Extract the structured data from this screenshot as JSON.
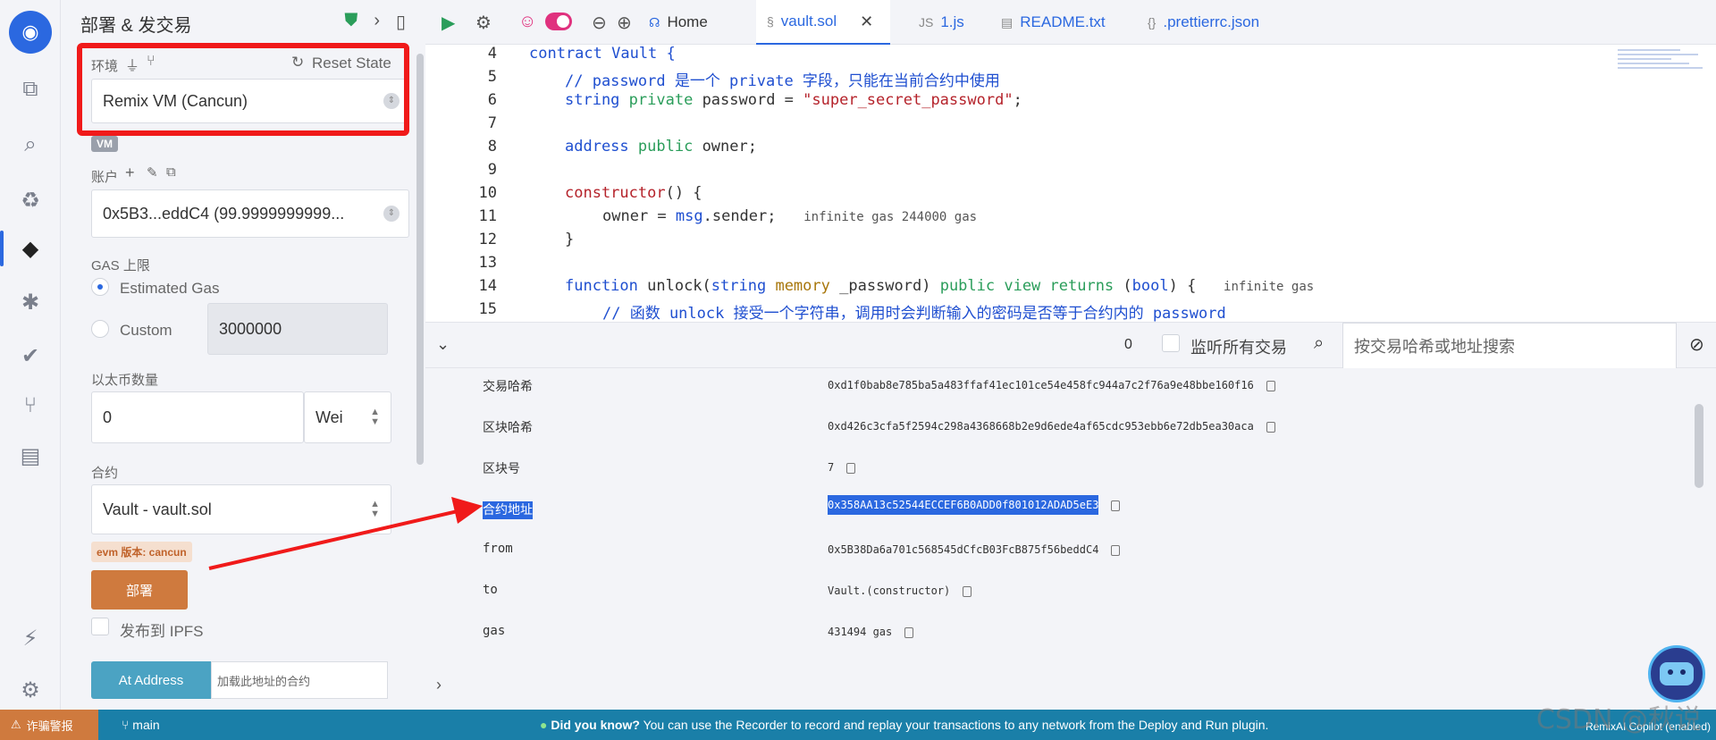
{
  "panel": {
    "title": "部署 & 发交易",
    "environment": {
      "label": "环境",
      "reset_label": "Reset State",
      "value": "Remix VM (Cancun)",
      "badge": "VM"
    },
    "account": {
      "label": "账户",
      "value": "0x5B3...eddC4 (99.9999999999..."
    },
    "gas": {
      "label": "GAS 上限",
      "estimated_label": "Estimated Gas",
      "custom_label": "Custom",
      "custom_value": "3000000",
      "selected": "Estimated Gas"
    },
    "value": {
      "label": "以太币数量",
      "amount": "0",
      "unit": "Wei"
    },
    "contract": {
      "label": "合约",
      "value": "Vault - vault.sol",
      "evm_badge": "evm 版本: cancun"
    },
    "deploy_label": "部署",
    "publish_ipfs_label": "发布到 IPFS",
    "at_address_label": "At Address",
    "at_address_placeholder": "加载此地址的合约"
  },
  "tabs": [
    {
      "label": "Home",
      "icon": "headset-icon"
    },
    {
      "label": "vault.sol",
      "icon": "solidity-icon",
      "active": true
    },
    {
      "label": "1.js",
      "icon": "js-icon"
    },
    {
      "label": "README.txt",
      "icon": "file-icon"
    },
    {
      "label": ".prettierrc.json",
      "icon": "json-icon"
    }
  ],
  "editor": {
    "lines": [
      {
        "num": "4"
      },
      {
        "num": "5"
      },
      {
        "num": "6"
      },
      {
        "num": "7"
      },
      {
        "num": "8"
      },
      {
        "num": "9"
      },
      {
        "num": "10"
      },
      {
        "num": "11"
      },
      {
        "num": "12"
      },
      {
        "num": "13"
      },
      {
        "num": "14"
      },
      {
        "num": "15"
      }
    ],
    "tokens": {
      "l4": "contract Vault {",
      "l5_comment": "// password 是一个 private 字段，只能在当前合约中使用",
      "l6_type": "string",
      "l6_vis": "private",
      "l6_rest": " password = ",
      "l6_str": "\"super_secret_password\"",
      "l6_end": ";",
      "l8_type": "address",
      "l8_vis": "public",
      "l8_rest": " owner;",
      "l10_fn": "constructor",
      "l10_rest": "() {",
      "l11_a": "owner = ",
      "l11_b": "msg",
      "l11_c": ".sender;",
      "l11_gas": "infinite gas 244000 gas",
      "l12": "}",
      "l14_kw": "function",
      "l14_a": " unlock(",
      "l14_type": "string",
      "l14_mem": "memory",
      "l14_b": " _password) ",
      "l14_vis": "public view returns",
      "l14_c": " (",
      "l14_bool": "bool",
      "l14_d": ") {",
      "l14_gas": "infinite gas",
      "l15_comment": "// 函数 unlock 接受一个字符串，调用时会判断输入的密码是否等于合约内的 password"
    }
  },
  "terminal": {
    "count": "0",
    "listen_label": "监听所有交易",
    "search_placeholder": "按交易哈希或地址搜索",
    "rows": [
      {
        "key": "交易哈希",
        "value": "0xd1f0bab8e785ba5a483ffaf41ec101ce54e458fc944a7c2f76a9e48bbe160f16"
      },
      {
        "key": "区块哈希",
        "value": "0xd426c3cfa5f2594c298a4368668b2e9d6ede4af65cdc953ebb6e72db5ea30aca"
      },
      {
        "key": "区块号",
        "value": "7"
      },
      {
        "key": "合约地址",
        "value": "0x358AA13c52544ECCEF6B0ADD0f801012ADAD5eE3"
      },
      {
        "key": "from",
        "value": "0x5B38Da6a701c568545dCfcB03FcB875f56beddC4"
      },
      {
        "key": "to",
        "value": "Vault.(constructor)"
      },
      {
        "key": "gas",
        "value": "431494 gas"
      }
    ]
  },
  "status": {
    "scam_label": "诈骗警报",
    "branch": "main",
    "tip_bold": "Did you know?",
    "tip_text": "You can use the Recorder to record and replay your transactions to any network from the Deploy and Run plugin.",
    "copilot": "RemixAI Copilot (enabled)"
  },
  "watermark": "CSDN @秋说",
  "colors": {
    "accent": "#2b68e0",
    "annotation_red": "#f01a1a",
    "deploy": "#cf7a3e",
    "status_bar": "#1a7fa8"
  }
}
